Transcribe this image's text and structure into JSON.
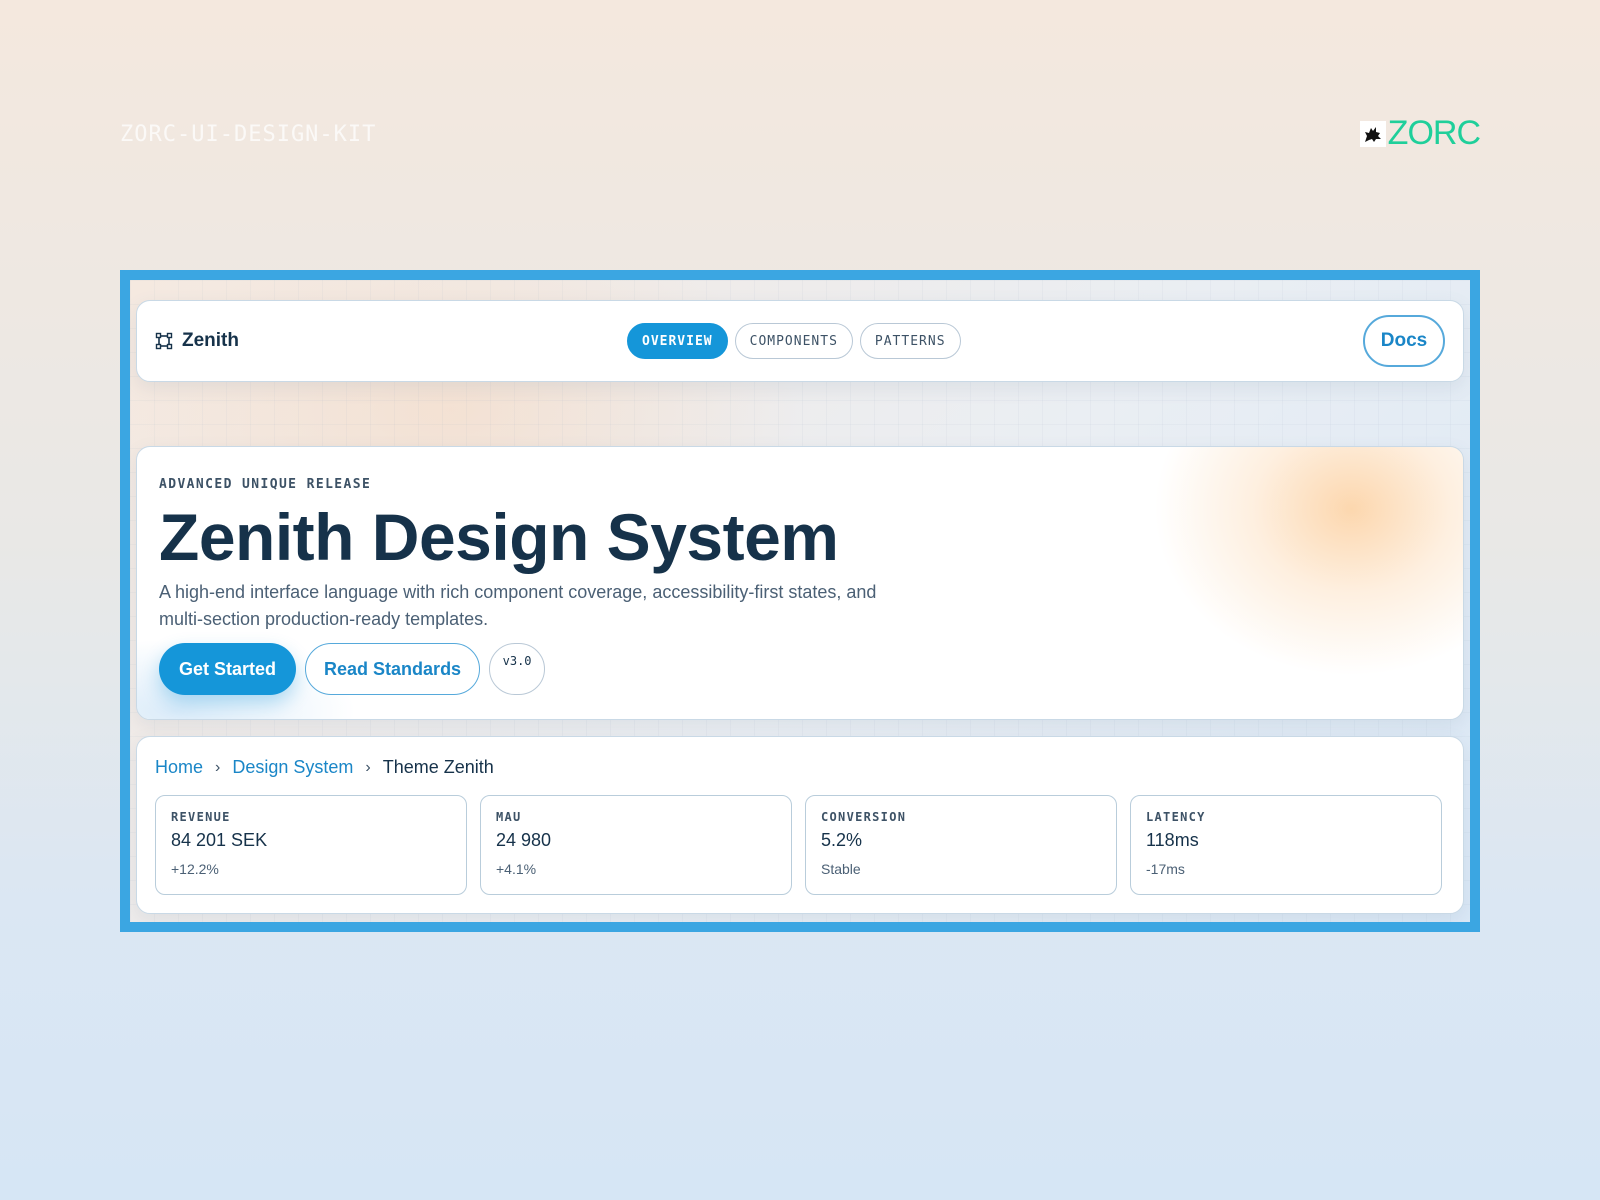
{
  "header": {
    "kit_label": "ZORC-UI-DESIGN-KIT",
    "brand_name": "ZORC",
    "brand_color": "#1fcf9a",
    "brand_icon": "wolf-icon"
  },
  "app": {
    "logo": {
      "icon": "frame-icon",
      "name": "Zenith"
    },
    "tabs": [
      {
        "label": "OVERVIEW",
        "active": true
      },
      {
        "label": "COMPONENTS",
        "active": false
      },
      {
        "label": "PATTERNS",
        "active": false
      }
    ],
    "docs_label": "Docs",
    "accent_color": "#1596d9",
    "frame_color": "#3ba6e2"
  },
  "hero": {
    "eyebrow": "ADVANCED UNIQUE RELEASE",
    "title": "Zenith Design System",
    "description": "A high-end interface language with rich component coverage, accessibility-first states, and multi-section production-ready templates.",
    "primary_label": "Get Started",
    "secondary_label": "Read Standards",
    "version": "v3.0"
  },
  "breadcrumb": {
    "items": [
      "Home",
      "Design System",
      "Theme Zenith"
    ],
    "separator_icon": "chevron-right-icon"
  },
  "metrics": [
    {
      "label": "REVENUE",
      "value": "84 201 SEK",
      "delta": "+12.2%"
    },
    {
      "label": "MAU",
      "value": "24 980",
      "delta": "+4.1%"
    },
    {
      "label": "CONVERSION",
      "value": "5.2%",
      "delta": "Stable"
    },
    {
      "label": "LATENCY",
      "value": "118ms",
      "delta": "-17ms"
    }
  ]
}
